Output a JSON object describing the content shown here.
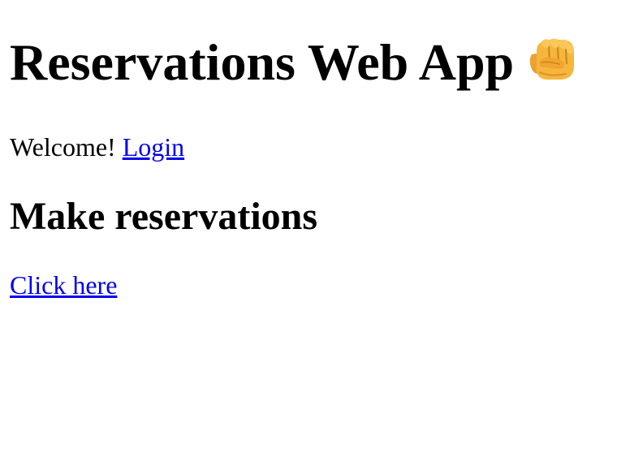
{
  "header": {
    "title": "Reservations Web App",
    "title_icon": "oncoming-fist-icon"
  },
  "welcome": {
    "text": "Welcome!",
    "login_link": "Login"
  },
  "reservations": {
    "heading": "Make reservations",
    "link": "Click here"
  },
  "colors": {
    "link": "#0000ee",
    "text": "#000000",
    "background": "#ffffff",
    "fist": "#f6b63c"
  }
}
